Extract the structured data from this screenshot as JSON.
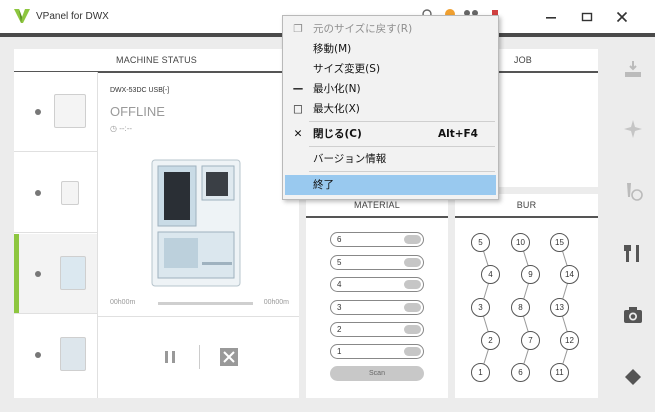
{
  "app": {
    "title": "VPanel for DWX"
  },
  "colors": {
    "accent_green": "#8dc63f",
    "menu_highlight": "#99c9ef"
  },
  "panels": {
    "machine_status": "MACHINE STATUS",
    "job": "JOB",
    "material": "MATERIAL",
    "bur": "BUR"
  },
  "machine": {
    "model": "DWX-53DC USB[-]",
    "status": "OFFLINE",
    "timer": "--:--",
    "elapsed": "00h00m",
    "remaining": "00h00m"
  },
  "material": {
    "slots": [
      "6",
      "5",
      "4",
      "3",
      "2",
      "1"
    ],
    "scan_label": "Scan"
  },
  "bur": {
    "columns": [
      [
        "5",
        "4",
        "3",
        "2",
        "1"
      ],
      [
        "10",
        "9",
        "8",
        "7",
        "6"
      ],
      [
        "15",
        "14",
        "13",
        "12",
        "11"
      ]
    ]
  },
  "menu": {
    "restore": "元のサイズに戻す(R)",
    "move": "移動(M)",
    "size": "サイズ変更(S)",
    "minimize": "最小化(N)",
    "maximize": "最大化(X)",
    "close": "閉じる(C)",
    "close_shortcut": "Alt+F4",
    "version": "バージョン情報",
    "exit": "終了"
  },
  "icons": {
    "sidebar": [
      "milling-icon",
      "sparkle-icon",
      "bur-time-icon",
      "tools-icon",
      "camera-icon",
      "diamond-icon"
    ]
  }
}
